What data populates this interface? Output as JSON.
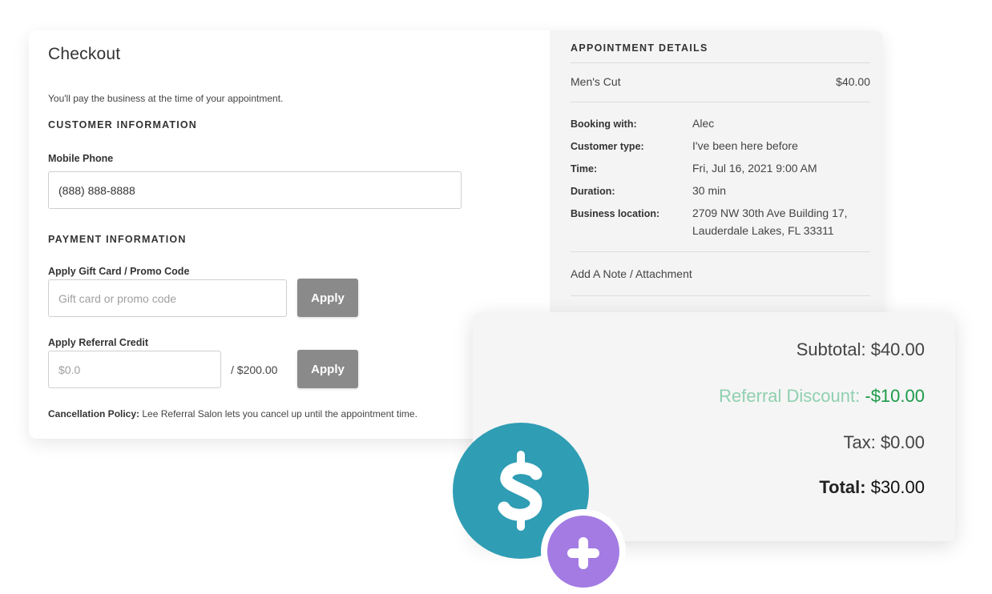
{
  "checkout": {
    "title": "Checkout",
    "pay_note": "You'll pay the business at the time of your appointment.",
    "customer_section": "CUSTOMER INFORMATION",
    "phone_label": "Mobile Phone",
    "phone_value": "(888) 888-8888",
    "payment_section": "PAYMENT INFORMATION",
    "gift_label": "Apply Gift Card / Promo Code",
    "gift_placeholder": "Gift card or promo code",
    "gift_apply": "Apply",
    "referral_label": "Apply Referral Credit",
    "referral_placeholder": "$0.0",
    "referral_max": "/  $200.00",
    "referral_apply": "Apply",
    "cancel_label": "Cancellation Policy:",
    "cancel_text": "Lee Referral Salon lets you cancel up until the appointment time."
  },
  "appointment": {
    "title": "APPOINTMENT DETAILS",
    "service": "Men's Cut",
    "price": "$40.00",
    "details": [
      {
        "label": "Booking with:",
        "value": "Alec"
      },
      {
        "label": "Customer type:",
        "value": "I've been here before"
      },
      {
        "label": "Time:",
        "value": "Fri, Jul 16, 2021 9:00 AM"
      },
      {
        "label": "Duration:",
        "value": "30 min"
      },
      {
        "label": "Business location:",
        "value": "2709 NW 30th Ave Building 17,",
        "value2": "Lauderdale Lakes, FL 33311"
      }
    ],
    "add_note": "Add A Note / Attachment"
  },
  "totals": {
    "subtotal_label": "Subtotal:",
    "subtotal_value": "$40.00",
    "discount_label": "Referral Discount:",
    "discount_value": "-$10.00",
    "tax_label": "Tax:",
    "tax_value": "$0.00",
    "total_label": "Total:",
    "total_value": "$30.00"
  },
  "colors": {
    "badge_teal": "#2f9db4",
    "badge_purple": "#a37be3",
    "button_gray": "#8a8a8a",
    "discount_green": "#1e9a4a"
  }
}
